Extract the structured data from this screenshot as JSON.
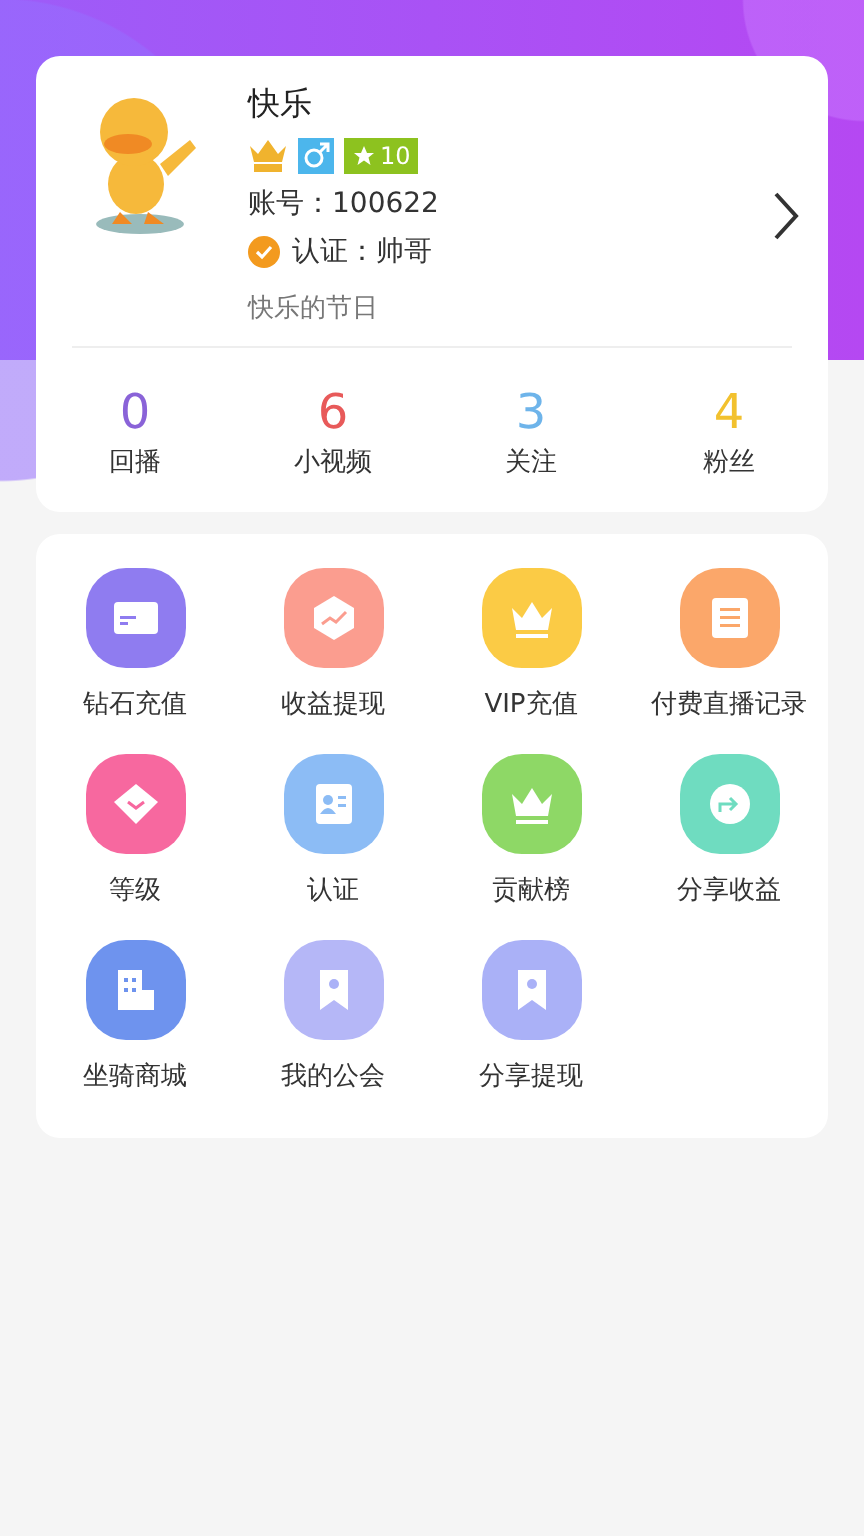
{
  "profile": {
    "name": "快乐",
    "badges": [
      {
        "kind": "vip"
      },
      {
        "kind": "male"
      },
      {
        "kind": "level",
        "text": "10"
      }
    ],
    "account": "账号：100622",
    "verified": true,
    "verification": "认证：帅哥",
    "signature": "快乐的节日"
  },
  "stats": [
    {
      "value": "0",
      "label": "回播",
      "color": "#8a63d8"
    },
    {
      "value": "6",
      "label": "小视频",
      "color": "#e85a5a"
    },
    {
      "value": "3",
      "label": "关注",
      "color": "#6eb4ea"
    },
    {
      "value": "4",
      "label": "粉丝",
      "color": "#f2c12e"
    }
  ],
  "menu": [
    {
      "label": "钻石充值",
      "kind": "card",
      "color": "#8f7cf0"
    },
    {
      "label": "收益提现",
      "kind": "chart",
      "color": "#fb9d8f"
    },
    {
      "label": "VIP充值",
      "kind": "crown",
      "color": "#fbcb45"
    },
    {
      "label": "付费直播记录",
      "kind": "list",
      "color": "#fba76a"
    },
    {
      "label": "等级",
      "kind": "gem",
      "color": "#f7689f"
    },
    {
      "label": "认证",
      "kind": "idcard",
      "color": "#8cbcf5"
    },
    {
      "label": "贡献榜",
      "kind": "crown",
      "color": "#8ed866"
    },
    {
      "label": "分享收益",
      "kind": "share",
      "color": "#6fdcc0"
    },
    {
      "label": "坐骑商城",
      "kind": "building",
      "color": "#6e93ee"
    },
    {
      "label": "我的公会",
      "kind": "bookmark",
      "color": "#b5b7f7"
    },
    {
      "label": "分享提现",
      "kind": "bookmark",
      "color": "#aab1f7"
    }
  ]
}
